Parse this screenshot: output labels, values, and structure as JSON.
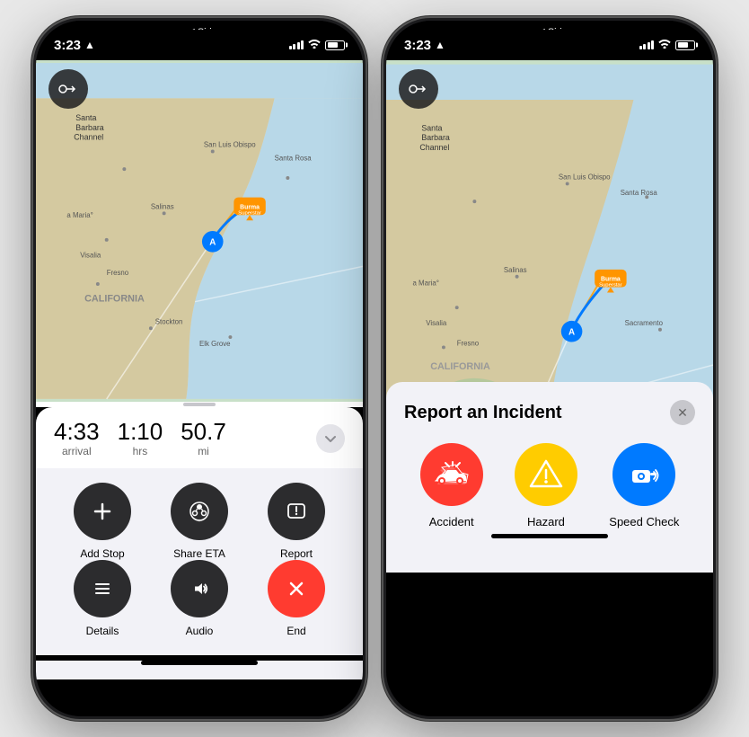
{
  "phone1": {
    "status": {
      "time": "3:23",
      "siri": "◀ Siri",
      "signal": "●●●",
      "wifi": "wifi",
      "battery": "battery"
    },
    "nav_button_icon": "→",
    "route": {
      "arrival_time": "4:33",
      "arrival_label": "arrival",
      "duration_value": "1:10",
      "duration_label": "hrs",
      "distance_value": "50.7",
      "distance_label": "mi"
    },
    "actions": [
      {
        "id": "add-stop",
        "icon": "+",
        "label": "Add Stop",
        "color": "dark"
      },
      {
        "id": "share-eta",
        "icon": "share-eta",
        "label": "Share ETA",
        "color": "dark"
      },
      {
        "id": "report",
        "icon": "!",
        "label": "Report",
        "color": "dark"
      },
      {
        "id": "details",
        "icon": "≡",
        "label": "Details",
        "color": "dark"
      },
      {
        "id": "audio",
        "icon": "♪",
        "label": "Audio",
        "color": "dark"
      },
      {
        "id": "end",
        "icon": "✕",
        "label": "End",
        "color": "red"
      }
    ]
  },
  "phone2": {
    "status": {
      "time": "3:23",
      "siri": "◀ Siri"
    },
    "incident": {
      "title": "Report an Incident",
      "close_label": "✕",
      "options": [
        {
          "id": "accident",
          "label": "Accident",
          "color": "red",
          "emoji": "🚗"
        },
        {
          "id": "hazard",
          "label": "Hazard",
          "color": "yellow",
          "emoji": "⚠️"
        },
        {
          "id": "speed-check",
          "label": "Speed Check",
          "color": "blue",
          "emoji": "📷"
        }
      ]
    }
  },
  "map": {
    "destination": "Burma Superstar",
    "origin_marker": "A",
    "california_label": "CALIFORNIA",
    "cities": [
      "Santa Barbara",
      "San Luis Obispo",
      "Fresno",
      "Salinas",
      "Visalia",
      "Stockton",
      "Elk Grove",
      "Santa Rosa"
    ]
  }
}
